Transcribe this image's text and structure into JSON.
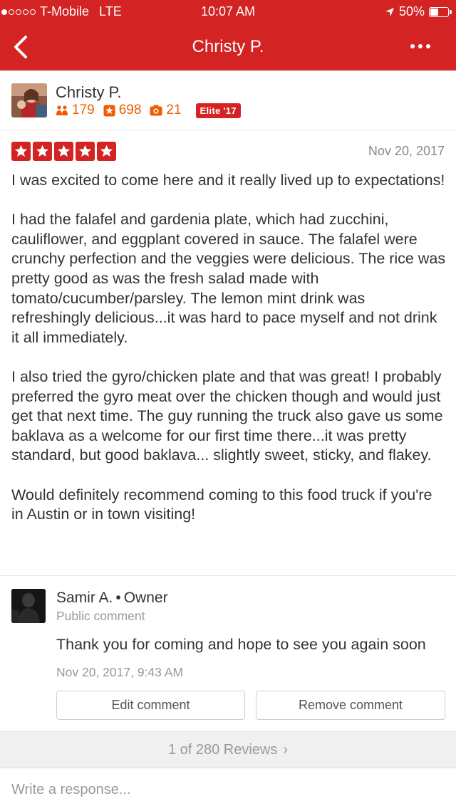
{
  "status_bar": {
    "signal_dots": [
      true,
      false,
      false,
      false,
      false
    ],
    "carrier": "T-Mobile",
    "network": "LTE",
    "time": "10:07 AM",
    "battery": "50%",
    "battery_level": 0.5
  },
  "nav": {
    "title": "Christy P."
  },
  "reviewer": {
    "name": "Christy P.",
    "friends": "179",
    "reviews": "698",
    "photos": "21",
    "elite_badge": "Elite '17"
  },
  "review": {
    "rating_stars": 5,
    "date": "Nov 20, 2017",
    "paragraphs": [
      "I was excited to come here and it really lived up to expectations!",
      "I had the falafel and gardenia plate, which had zucchini, cauliflower, and eggplant covered in sauce. The falafel were crunchy perfection and the veggies were delicious. The rice was pretty good as was the fresh salad made with tomato/cucumber/parsley. The lemon mint drink was refreshingly delicious...it was hard to pace myself and not drink it all immediately.",
      "I also tried the gyro/chicken plate and that was great! I probably preferred the gyro meat over the chicken though and would just get that next time. The guy running the truck also gave us some baklava as a welcome for our first time there...it was pretty standard, but good baklava... slightly sweet, sticky, and flakey.",
      "Would definitely recommend coming to this food truck if you're in Austin or in town visiting!"
    ]
  },
  "owner_comment": {
    "name": "Samir A.",
    "separator": "•",
    "role": "Owner",
    "visibility": "Public comment",
    "text": "Thank you for coming and hope to see you again soon",
    "date": "Nov 20, 2017, 9:43 AM",
    "edit_label": "Edit comment",
    "remove_label": "Remove comment"
  },
  "pager": {
    "label": "1 of 280 Reviews",
    "chevron": "›"
  },
  "response": {
    "placeholder": "Write a response..."
  },
  "colors": {
    "brand_red": "#d32323",
    "stat_orange": "#f15c00"
  }
}
